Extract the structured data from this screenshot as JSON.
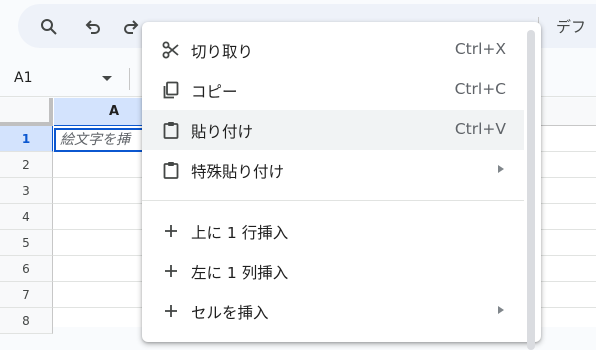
{
  "toolbar": {
    "font_label": "デフ",
    "items": [
      "search-icon",
      "undo-icon",
      "redo-icon"
    ]
  },
  "namebox": {
    "value": "A1"
  },
  "grid": {
    "column_header": "A",
    "rows": [
      "1",
      "2",
      "3",
      "4",
      "5",
      "6",
      "7",
      "8"
    ],
    "a1_placeholder": "絵文字を挿"
  },
  "menu": {
    "items": [
      {
        "icon": "scissors-icon",
        "label": "切り取り",
        "shortcut": "Ctrl+X",
        "submenu": false
      },
      {
        "icon": "copy-icon",
        "label": "コピー",
        "shortcut": "Ctrl+C",
        "submenu": false
      },
      {
        "icon": "clipboard-icon",
        "label": "貼り付け",
        "shortcut": "Ctrl+V",
        "submenu": false
      },
      {
        "icon": "clipboard-icon",
        "label": "特殊貼り付け",
        "shortcut": "",
        "submenu": true
      },
      {
        "icon": "plus-icon",
        "label": "上に 1 行挿入",
        "shortcut": "",
        "submenu": false
      },
      {
        "icon": "plus-icon",
        "label": "左に 1 列挿入",
        "shortcut": "",
        "submenu": false
      },
      {
        "icon": "plus-icon",
        "label": "セルを挿入",
        "shortcut": "",
        "submenu": true
      }
    ]
  }
}
